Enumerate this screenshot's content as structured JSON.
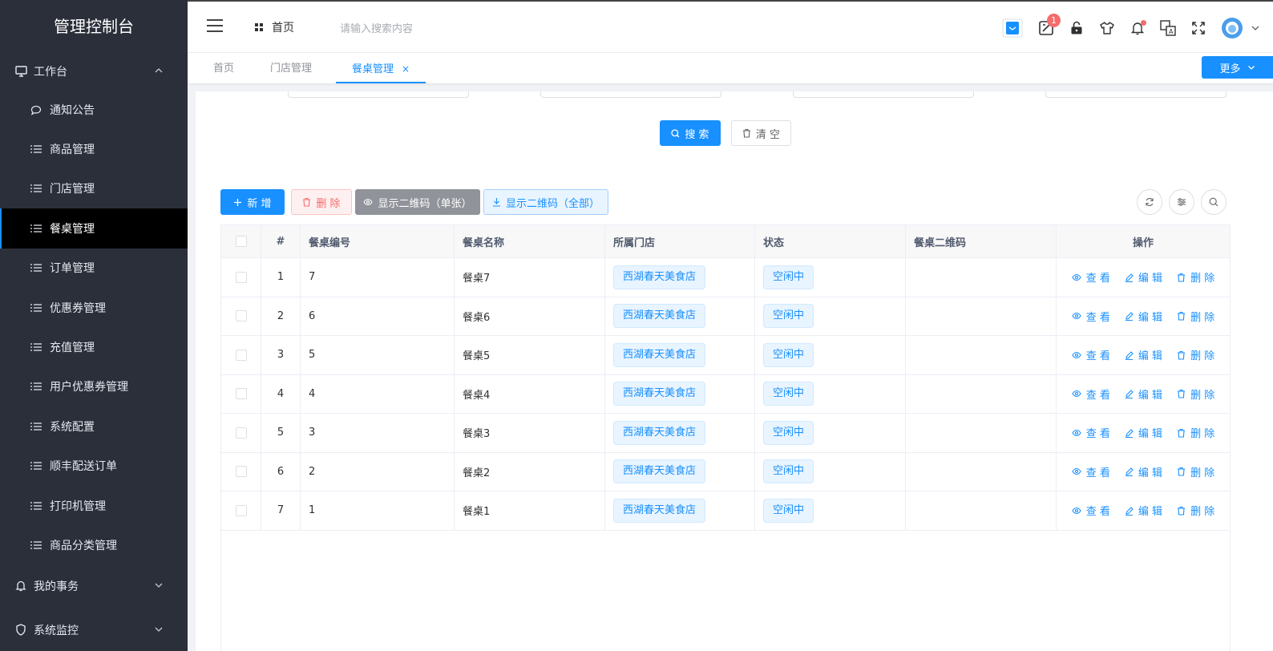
{
  "sidebar": {
    "logo": "管理控制台",
    "group_workbench": "工作台",
    "items": [
      {
        "label": "通知公告",
        "icon": "chat-icon"
      },
      {
        "label": "商品管理",
        "icon": "list-icon"
      },
      {
        "label": "门店管理",
        "icon": "list-icon"
      },
      {
        "label": "餐桌管理",
        "icon": "list-icon",
        "active": true
      },
      {
        "label": "订单管理",
        "icon": "list-icon"
      },
      {
        "label": "优惠券管理",
        "icon": "list-icon"
      },
      {
        "label": "充值管理",
        "icon": "list-icon"
      },
      {
        "label": "用户优惠券管理",
        "icon": "list-icon"
      },
      {
        "label": "系统配置",
        "icon": "list-icon"
      },
      {
        "label": "顺丰配送订单",
        "icon": "list-icon"
      },
      {
        "label": "打印机管理",
        "icon": "list-icon"
      },
      {
        "label": "商品分类管理",
        "icon": "list-icon"
      }
    ],
    "group_affairs": "我的事务",
    "group_monitor": "系统监控"
  },
  "header": {
    "home_label": "首页",
    "search_placeholder": "请输入搜索内容",
    "notice_badge": "1"
  },
  "tags": {
    "items": [
      "首页",
      "门店管理",
      "餐桌管理"
    ],
    "close": "×",
    "more": "更多"
  },
  "toolbar": {
    "search": "搜 索",
    "clear": "清 空",
    "add": "新 增",
    "delete": "删 除",
    "qr_single": "显示二维码（单张）",
    "qr_all": "显示二维码（全部）"
  },
  "table": {
    "columns": [
      "#",
      "餐桌编号",
      "餐桌名称",
      "所属门店",
      "状态",
      "餐桌二维码",
      "操作"
    ],
    "rows": [
      {
        "index": "1",
        "code": "7",
        "name": "餐桌7",
        "store": "西湖春天美食店",
        "status": "空闲中"
      },
      {
        "index": "2",
        "code": "6",
        "name": "餐桌6",
        "store": "西湖春天美食店",
        "status": "空闲中"
      },
      {
        "index": "3",
        "code": "5",
        "name": "餐桌5",
        "store": "西湖春天美食店",
        "status": "空闲中"
      },
      {
        "index": "4",
        "code": "4",
        "name": "餐桌4",
        "store": "西湖春天美食店",
        "status": "空闲中"
      },
      {
        "index": "5",
        "code": "3",
        "name": "餐桌3",
        "store": "西湖春天美食店",
        "status": "空闲中"
      },
      {
        "index": "6",
        "code": "2",
        "name": "餐桌2",
        "store": "西湖春天美食店",
        "status": "空闲中"
      },
      {
        "index": "7",
        "code": "1",
        "name": "餐桌1",
        "store": "西湖春天美食店",
        "status": "空闲中"
      }
    ],
    "ops": {
      "view": "查 看",
      "edit": "编 辑",
      "delete": "删 除"
    }
  },
  "colors": {
    "primary": "#1890ff",
    "sidebar_bg": "#2b2f3a",
    "danger": "#f56c6c"
  }
}
